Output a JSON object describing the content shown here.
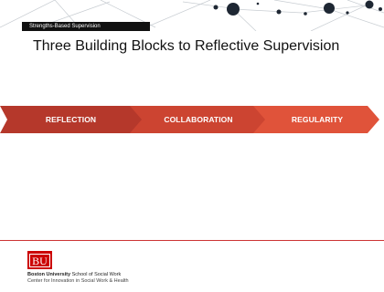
{
  "header": {
    "tab_label": "Strengths-Based Supervision"
  },
  "slide": {
    "title": "Three Building Blocks to Reflective Supervision"
  },
  "process": {
    "steps": [
      {
        "label": "REFLECTION",
        "color": "#b5382b"
      },
      {
        "label": "COLLABORATION",
        "color": "#cc4431"
      },
      {
        "label": "REGULARITY",
        "color": "#e0533a"
      }
    ]
  },
  "footer": {
    "logo_text": "BU",
    "org_bold": "Boston University",
    "org_rest": " School of Social Work",
    "center": "Center for Innovation in Social Work & Health",
    "accent": "#cc0000"
  }
}
